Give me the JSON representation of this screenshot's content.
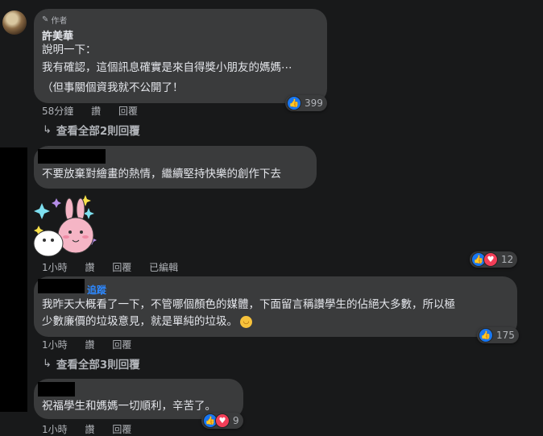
{
  "comments": [
    {
      "author_badge": "作者",
      "author": "許美華",
      "lines": [
        "說明一下：",
        "我有確認，這個訊息確實是來自得獎小朋友的媽媽⋯",
        "（但事關個資我就不公開了！"
      ],
      "time": "58分鐘",
      "like": "讚",
      "reply": "回覆",
      "reactions": "399",
      "view_replies": "查看全部2則回覆"
    },
    {
      "line": "不要放棄對繪畫的熱情，繼續堅持快樂的創作下去",
      "time": "1小時",
      "like": "讚",
      "reply": "回覆",
      "edited": "已編輯",
      "reactions": "12"
    },
    {
      "follow": "追蹤",
      "lines": [
        "我昨天大概看了一下，不管哪個顏色的媒體，下面留言稱讚學生的佔絕大多數，所以極",
        "少數廉價的垃圾意見，就是單純的垃圾。"
      ],
      "time": "1小時",
      "like": "讚",
      "reply": "回覆",
      "reactions": "175",
      "view_replies": "查看全部3則回覆"
    },
    {
      "line": "祝福學生和媽媽一切順利，辛苦了。",
      "time": "1小時",
      "like": "讚",
      "reply": "回覆",
      "reactions": "9"
    }
  ],
  "icons": {
    "like": "thumbs-up-icon",
    "love": "heart-icon",
    "reply_arrow": "reply-arrow-icon",
    "pencil": "pencil-icon",
    "emoji": "blush-emoji-icon"
  },
  "colors": {
    "background": "#18191a",
    "bubble": "#3a3b3c",
    "like": "#1877f2",
    "love": "#f33e58",
    "link": "#2d88ff"
  }
}
